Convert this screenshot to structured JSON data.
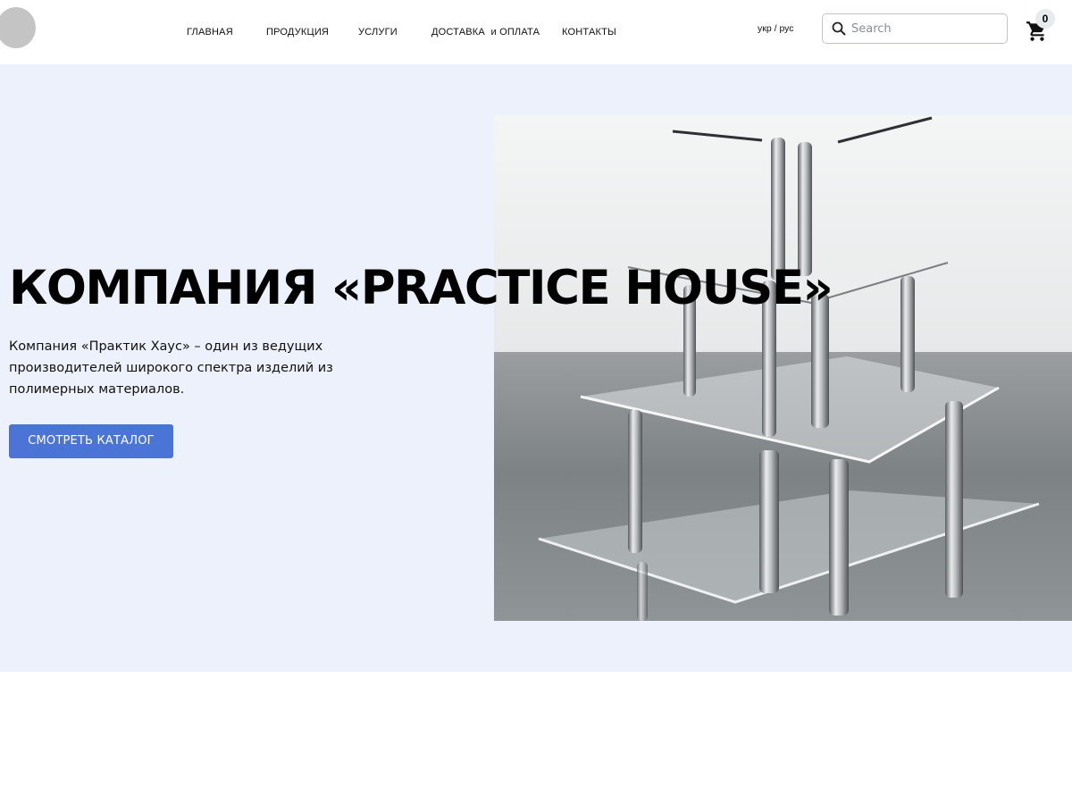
{
  "header": {
    "nav": [
      {
        "label": "ГЛАВНАЯ"
      },
      {
        "label": "ПРОДУКЦИЯ"
      },
      {
        "label": "УСЛУГИ"
      },
      {
        "label": "ДОСТАВКА  и ОПЛАТА"
      },
      {
        "label": "КОНТАКТЫ"
      }
    ],
    "lang": {
      "ukr": "укр",
      "sep": " / ",
      "rus": "рус"
    },
    "search": {
      "placeholder": "Search",
      "icon": "search-icon"
    },
    "cart": {
      "count": "0",
      "icon": "cart-icon"
    }
  },
  "hero": {
    "title": "КОМПАНИЯ «PRACTICE HOUSE»",
    "description": "Компания «Практик Хаус» – один из ведущих производителей широкого спектра изделий из полимерных материалов.",
    "button_label": "СМОТРЕТЬ КАТАЛОГ",
    "image": "acrylic-tiered-stand-photo"
  },
  "colors": {
    "hero_background": "#edf1fb",
    "button": "#4a74d6",
    "logo_placeholder": "#c4c4c4"
  }
}
